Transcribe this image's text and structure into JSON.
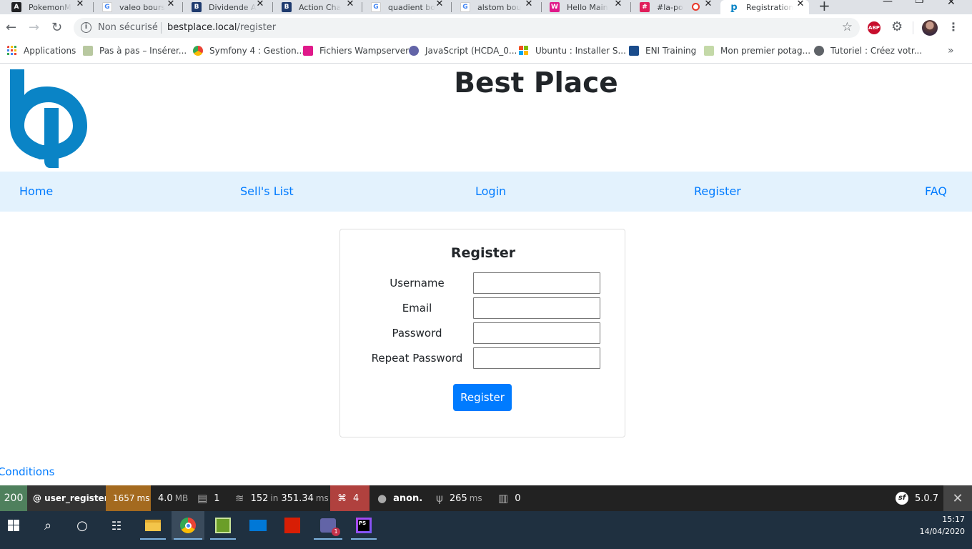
{
  "browser": {
    "tabs": [
      {
        "label": "PokemonM",
        "favicon": "angular-icon",
        "color": "#202124"
      },
      {
        "label": "valeo bours",
        "favicon": "google-icon",
        "color": "#4285f4"
      },
      {
        "label": "Dividende A",
        "favicon": "boursier-icon",
        "color": "#1e3a6e"
      },
      {
        "label": "Action Cha",
        "favicon": "boursier-icon",
        "color": "#1e3a6e"
      },
      {
        "label": "quadient bo",
        "favicon": "google-icon",
        "color": "#4285f4"
      },
      {
        "label": "alstom bou",
        "favicon": "google-icon",
        "color": "#4285f4"
      },
      {
        "label": "Hello Main",
        "favicon": "wamp-icon",
        "color": "#e0198a"
      },
      {
        "label": "#la-po",
        "favicon": "slack-icon",
        "color": "#e01e5a"
      },
      {
        "label": "Registration",
        "favicon": "bestplace-icon",
        "color": "#0a84c6"
      }
    ],
    "new_tab": "+",
    "address": {
      "security_label": "Non sécurisé",
      "host": "bestplace.local",
      "path": "/register"
    },
    "extension": "ABP",
    "bookmarks": [
      {
        "label": "Applications",
        "icon": "apps-grid-icon",
        "color": "#ea4335"
      },
      {
        "label": "Pas à pas – Insérer...",
        "icon": "page-icon",
        "color": "#b8c8a0"
      },
      {
        "label": "Symfony 4 : Gestion...",
        "icon": "chrome-icon",
        "color": "#fbbc05"
      },
      {
        "label": "Fichiers Wampserver",
        "icon": "wamp-icon",
        "color": "#e0198a"
      },
      {
        "label": "JavaScript (HCDA_0...",
        "icon": "teams-icon",
        "color": "#6264a7"
      },
      {
        "label": "Ubuntu : Installer S...",
        "icon": "microsoft-icon",
        "color": "#f25022"
      },
      {
        "label": "ENI Training",
        "icon": "eni-icon",
        "color": "#1a4c8b"
      },
      {
        "label": "Mon premier potag...",
        "icon": "leaf-icon",
        "color": "#c4d9a8"
      },
      {
        "label": "Tutoriel : Créez votr...",
        "icon": "globe-icon",
        "color": "#5f6368"
      }
    ],
    "bookmarks_more": "»"
  },
  "site": {
    "title": "Best Place",
    "brand_color": "#0a84c6",
    "nav": [
      "Home",
      "Sell's List",
      "Login",
      "Register",
      "FAQ"
    ],
    "form": {
      "heading": "Register",
      "fields": [
        {
          "label": "Username",
          "value": ""
        },
        {
          "label": "Email",
          "value": ""
        },
        {
          "label": "Password",
          "value": ""
        },
        {
          "label": "Repeat Password",
          "value": ""
        }
      ],
      "submit_label": "Register"
    },
    "footer_link": "Conditions"
  },
  "profiler": {
    "status": "200",
    "route": "@ user_register",
    "time": "1657",
    "time_unit": "ms",
    "memory": "4.0",
    "memory_unit": "MB",
    "logs": "1",
    "cache": "152",
    "cache_in": "in",
    "cache_time": "351.34",
    "cache_unit": "ms",
    "translation": "4",
    "user": "anon.",
    "twig": "265",
    "twig_unit": "ms",
    "db": "0",
    "version": "5.0.7",
    "close": "✕"
  },
  "taskbar": {
    "time": "15:17",
    "date": "14/04/2020"
  }
}
